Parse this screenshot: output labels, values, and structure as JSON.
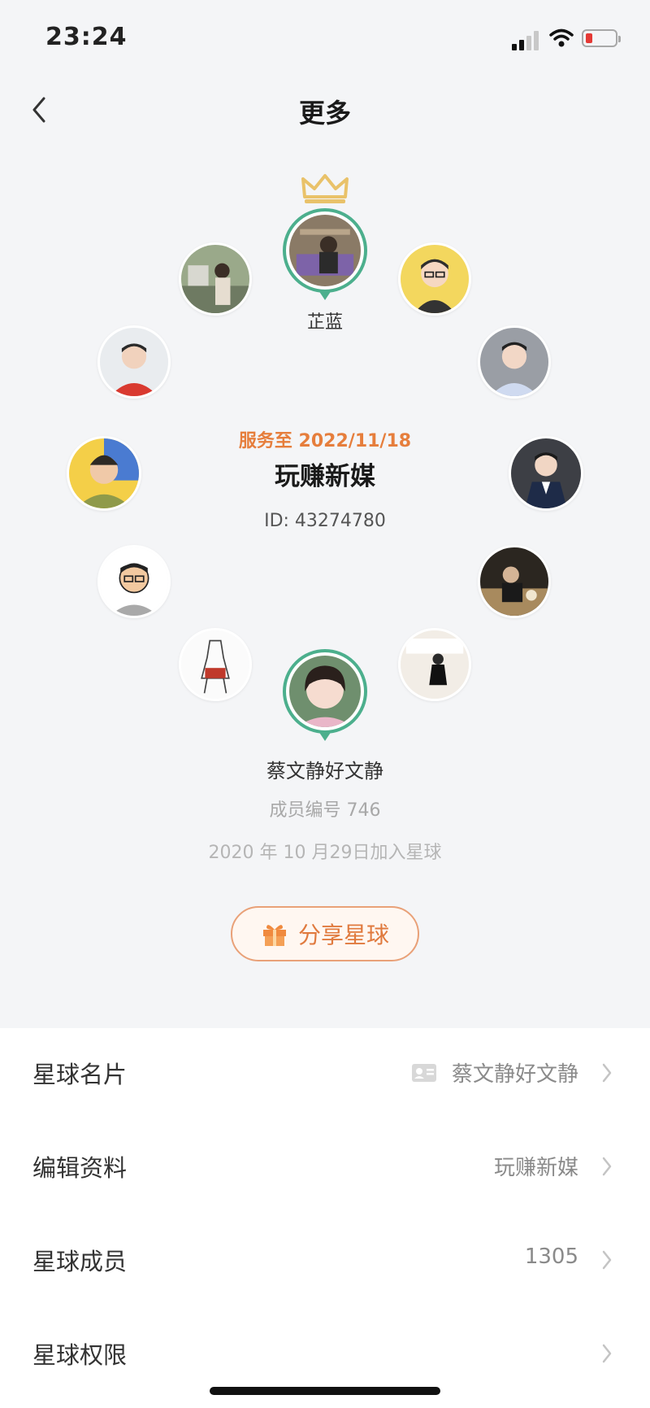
{
  "status_bar": {
    "time": "23:24"
  },
  "nav": {
    "title": "更多"
  },
  "owner": {
    "name": "芷蓝"
  },
  "planet": {
    "service_until": "服务至 2022/11/18",
    "name": "玩赚新媒",
    "id_text": "ID: 43274780"
  },
  "member": {
    "name": "蔡文静好文静",
    "number_text": "成员编号 746",
    "joined_text": "2020 年 10 月29日加入星球"
  },
  "share": {
    "label": "分享星球"
  },
  "menu": [
    {
      "label": "星球名片",
      "value": "蔡文静好文静"
    },
    {
      "label": "编辑资料",
      "value": "玩赚新媒"
    },
    {
      "label": "星球成员",
      "value": "1305"
    },
    {
      "label": "星球权限",
      "value": ""
    }
  ],
  "colors": {
    "accent_green": "#4caf8d",
    "accent_orange": "#e67e3c",
    "crown_gold": "#e9c26a"
  },
  "icons": [
    "back-chevron-icon",
    "crown-icon",
    "gift-icon",
    "id-card-icon",
    "chevron-right-icon",
    "wifi-icon",
    "battery-icon",
    "signal-icon"
  ]
}
